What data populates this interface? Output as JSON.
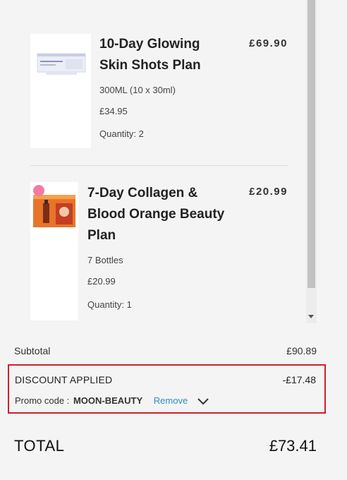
{
  "cart": {
    "items": [
      {
        "name": "10-Day Glowing Skin Shots Plan",
        "line_total": "£69.90",
        "size": "300ML (10 x 30ml)",
        "unit_price": "£34.95",
        "quantity": "Quantity: 2"
      },
      {
        "name": "7-Day Collagen & Blood Orange Beauty Plan",
        "line_total": "£20.99",
        "size": "7 Bottles",
        "unit_price": "£20.99",
        "quantity": "Quantity: 1"
      }
    ]
  },
  "summary": {
    "subtotal_label": "Subtotal",
    "subtotal_value": "£90.89",
    "discount_label": "Discount Applied",
    "discount_value": "-£17.48",
    "promo_prefix": "Promo code :",
    "promo_code": "MOON-BEAUTY",
    "remove_label": "Remove",
    "total_label": "TOTAL",
    "total_value": "£73.41"
  },
  "colors": {
    "highlight_border": "#d01e2a",
    "link": "#2a8fc7"
  }
}
